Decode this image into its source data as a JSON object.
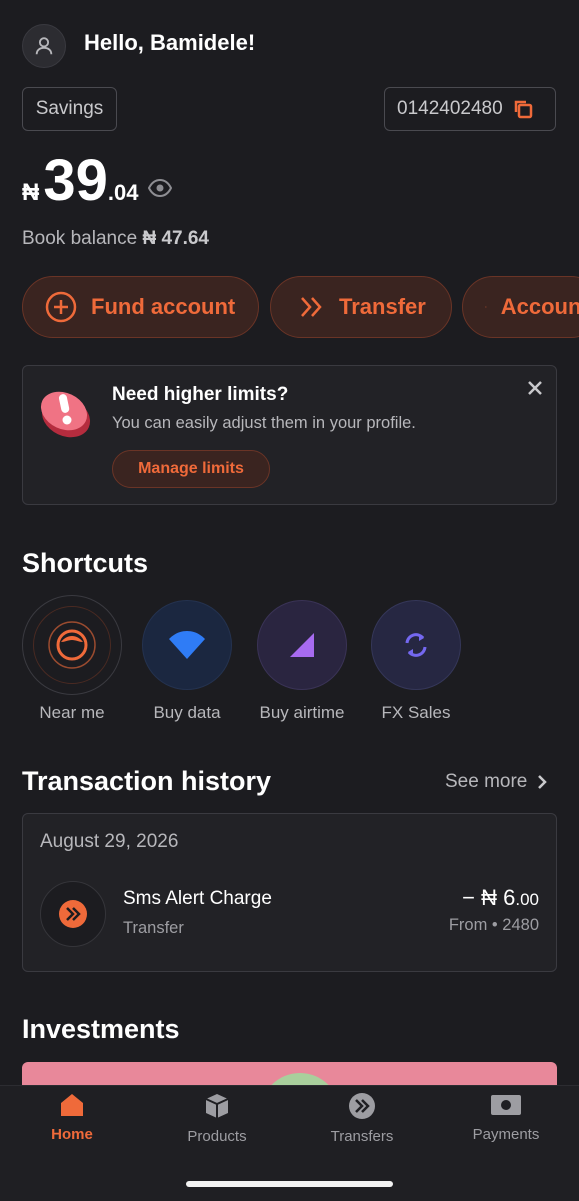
{
  "header": {
    "greeting": "Hello, Bamidele!"
  },
  "account": {
    "type_label": "Savings",
    "number": "0142402480",
    "currency_symbol": "₦",
    "balance_whole": "39",
    "balance_decimal": ".04",
    "book_balance_label": "Book balance",
    "book_balance_value": "₦ 47.64"
  },
  "actions": [
    {
      "label": "Fund account",
      "icon": "plus-circle-icon"
    },
    {
      "label": "Transfer",
      "icon": "double-chevron-icon"
    },
    {
      "label": "Accounts",
      "icon": "menu-lines-icon"
    }
  ],
  "limits_banner": {
    "title": "Need higher limits?",
    "text": "You can easily adjust them in your profile.",
    "button": "Manage limits"
  },
  "shortcuts": {
    "title": "Shortcuts",
    "items": [
      {
        "label": "Near me",
        "icon": "location-face-icon"
      },
      {
        "label": "Buy data",
        "icon": "wifi-icon"
      },
      {
        "label": "Buy airtime",
        "icon": "signal-icon"
      },
      {
        "label": "FX Sales",
        "icon": "exchange-icon"
      }
    ]
  },
  "transactions": {
    "title": "Transaction history",
    "see_more": "See more",
    "date": "August 29, 2026",
    "items": [
      {
        "title": "Sms Alert Charge",
        "type": "Transfer",
        "amount_main": "− ₦ 6",
        "amount_decimal": ".00",
        "from": "From • 2480"
      }
    ]
  },
  "investments": {
    "title": "Investments"
  },
  "nav": {
    "items": [
      {
        "label": "Home",
        "active": true
      },
      {
        "label": "Products",
        "active": false
      },
      {
        "label": "Transfers",
        "active": false
      },
      {
        "label": "Payments",
        "active": false
      }
    ]
  },
  "colors": {
    "accent": "#ef6a3a",
    "background": "#1c1c20",
    "card": "#222226"
  }
}
